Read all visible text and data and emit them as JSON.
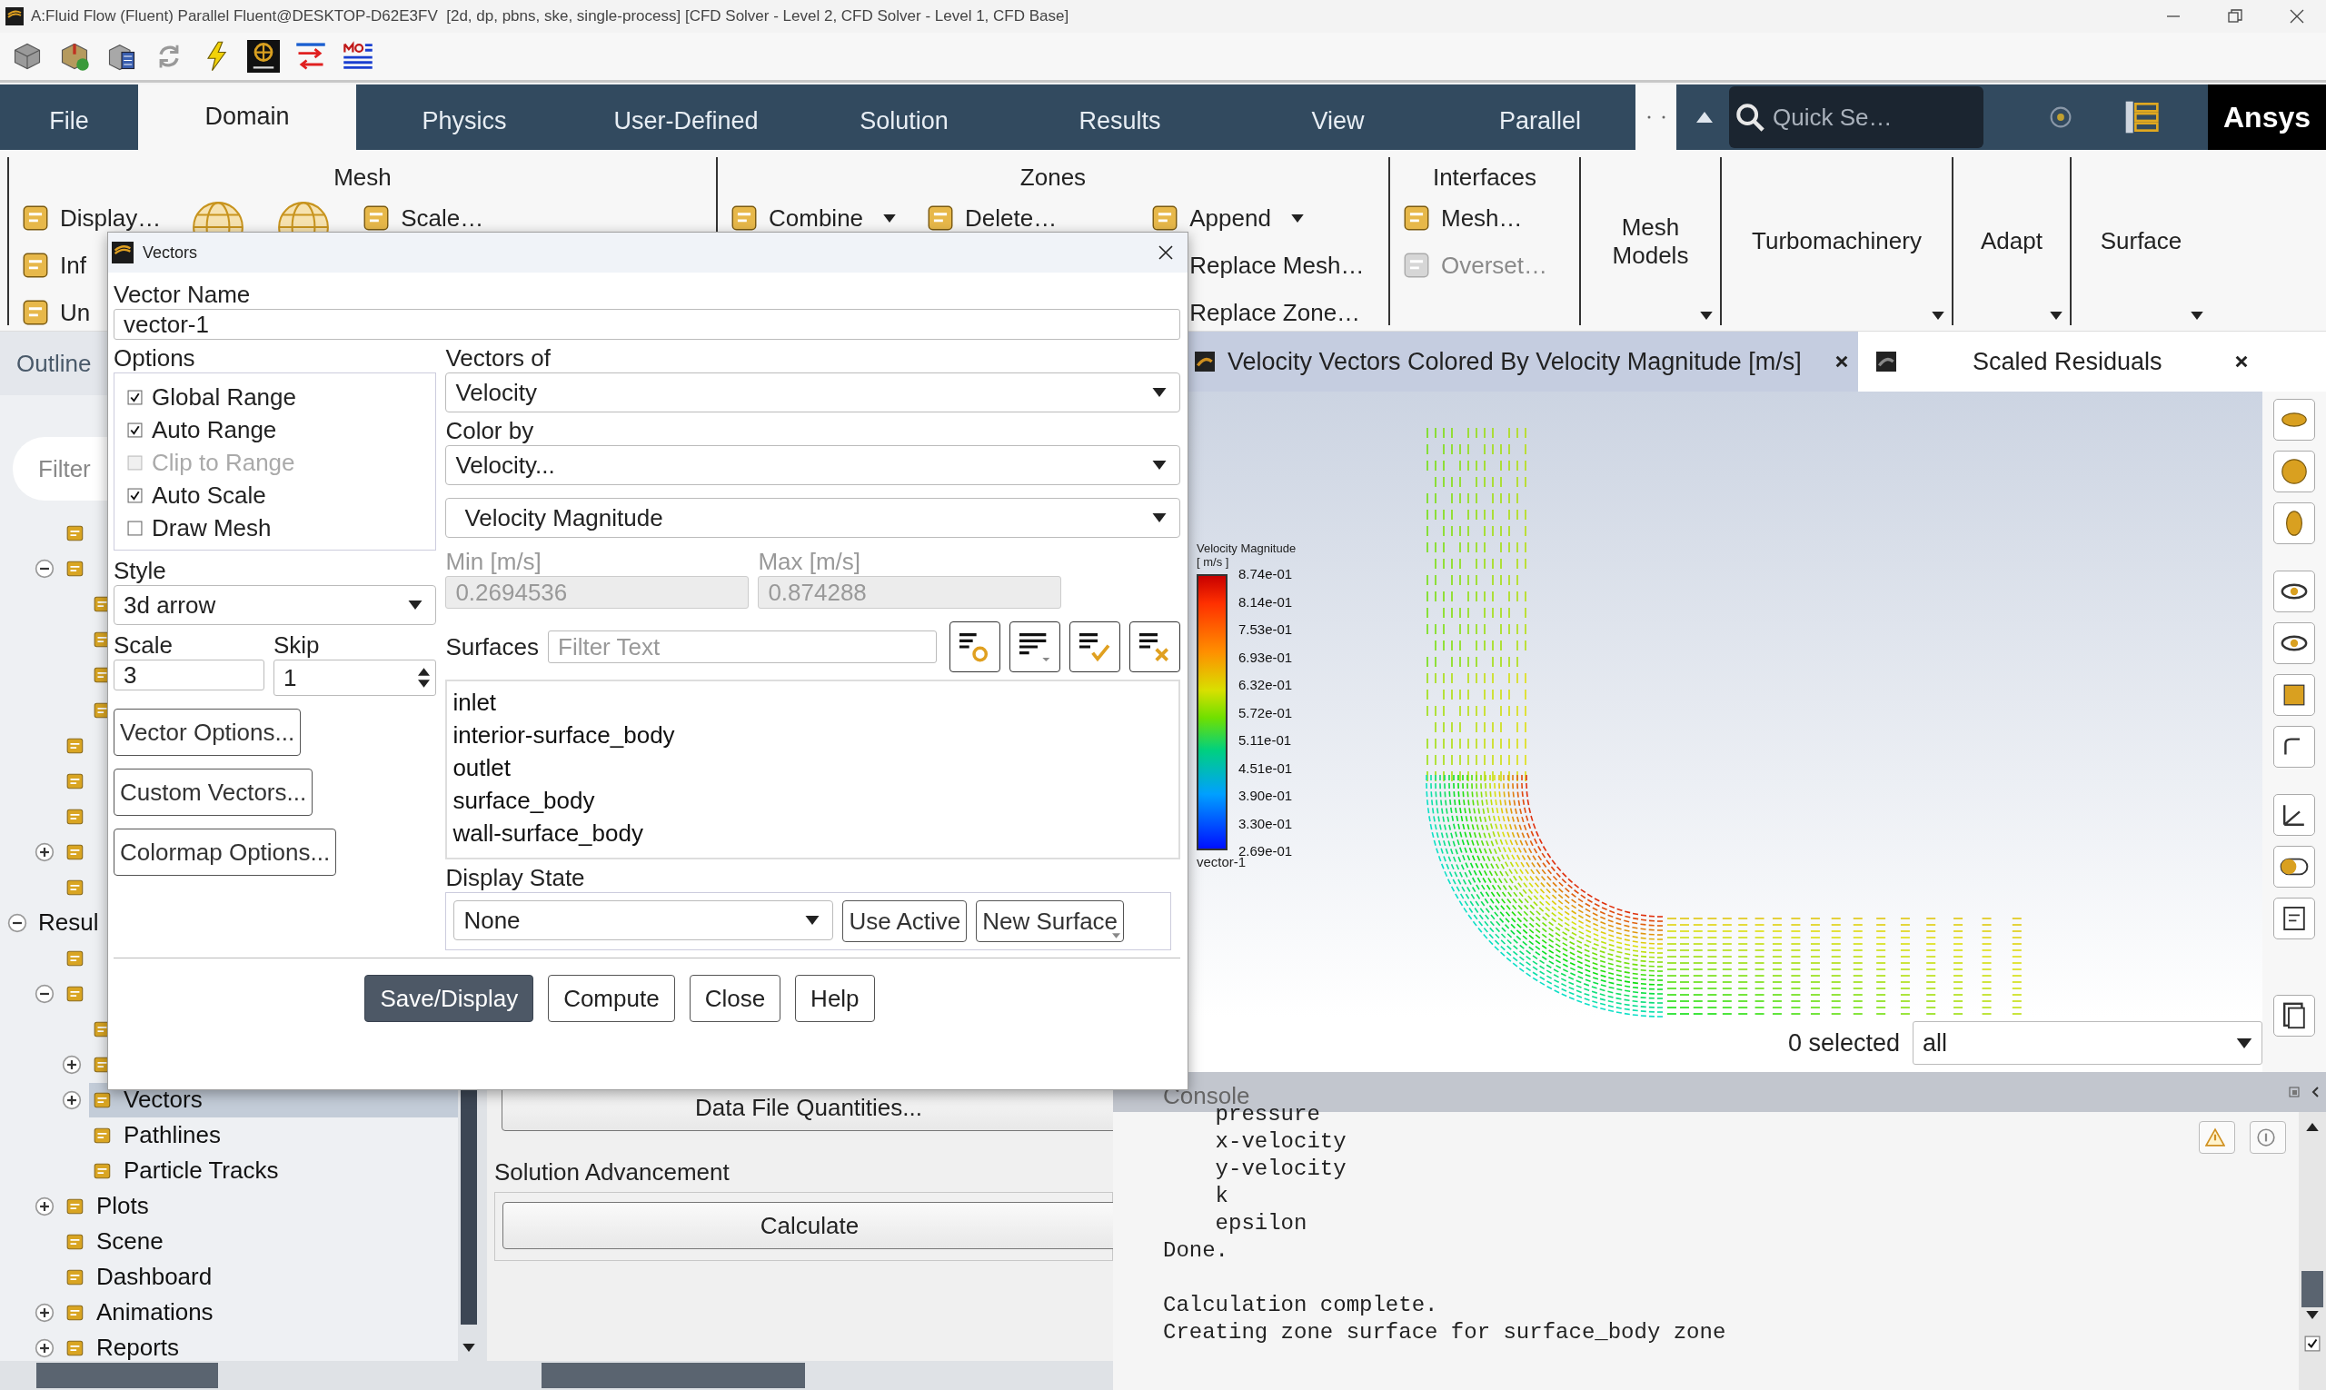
{
  "window": {
    "title": "A:Fluid Flow (Fluent) Parallel Fluent@DESKTOP-D62E3FV  [2d, dp, pbns, ske, single-process] [CFD Solver - Level 2, CFD Solver - Level 1, CFD Base]"
  },
  "ribbon_tabs": [
    {
      "label": "File",
      "selected": false
    },
    {
      "label": "Domain",
      "selected": true
    },
    {
      "label": "Physics",
      "selected": false
    },
    {
      "label": "User-Defined",
      "selected": false
    },
    {
      "label": "Solution",
      "selected": false
    },
    {
      "label": "Results",
      "selected": false
    },
    {
      "label": "View",
      "selected": false
    },
    {
      "label": "Parallel",
      "selected": false
    }
  ],
  "quick_search": {
    "placeholder": "Quick Se…"
  },
  "brand": "Ansys",
  "ribbon_groups": [
    {
      "title": "Mesh",
      "kind": "commands",
      "columns": [
        [
          {
            "kind": "command",
            "label": "Display…",
            "dropdown": false,
            "disabled": false
          },
          {
            "kind": "command",
            "label": "Inf",
            "dropdown": false,
            "disabled": false
          },
          {
            "kind": "command",
            "label": "Un",
            "dropdown": false,
            "disabled": false
          }
        ],
        [
          {
            "kind": "icon"
          }
        ],
        [
          {
            "kind": "icon"
          }
        ],
        [
          {
            "kind": "command",
            "label": "Scale…",
            "dropdown": false,
            "disabled": false
          }
        ]
      ]
    },
    {
      "title": "Zones",
      "kind": "commands",
      "columns": [
        [
          {
            "kind": "command",
            "label": "Combine",
            "dropdown": true,
            "disabled": false
          }
        ],
        [
          {
            "kind": "command",
            "label": "Delete…",
            "dropdown": false,
            "disabled": false
          }
        ],
        [
          {
            "kind": "command",
            "label": "Append",
            "dropdown": true,
            "disabled": false
          },
          {
            "kind": "command",
            "label": "Replace Mesh…",
            "dropdown": false,
            "disabled": false
          },
          {
            "kind": "command",
            "label": "Replace Zone…",
            "dropdown": false,
            "disabled": false
          }
        ]
      ]
    },
    {
      "title": "Interfaces",
      "kind": "commands",
      "columns": [
        [
          {
            "kind": "command",
            "label": "Mesh…",
            "dropdown": false,
            "disabled": false
          },
          {
            "kind": "command",
            "label": "Overset…",
            "dropdown": false,
            "disabled": true
          }
        ]
      ]
    },
    {
      "title": "Mesh Models",
      "kind": "menu"
    },
    {
      "title": "Turbomachinery",
      "kind": "menu"
    },
    {
      "title": "Adapt",
      "kind": "menu"
    },
    {
      "title": "Surface",
      "kind": "menu"
    }
  ],
  "outline": {
    "title": "Outline",
    "filter_placeholder": "Filter"
  },
  "tree": {
    "continued": [
      {
        "expandable": false,
        "selected": false
      },
      {
        "expandable": true,
        "expanded": true,
        "selected": false,
        "children": [
          {
            "expandable": false,
            "selected": false
          },
          {
            "expandable": false,
            "selected": false
          },
          {
            "expandable": false,
            "selected": false
          },
          {
            "expandable": false,
            "selected": false
          }
        ]
      },
      {
        "expandable": false,
        "selected": false
      },
      {
        "expandable": false,
        "selected": false
      },
      {
        "expandable": false,
        "selected": false
      },
      {
        "expandable": true,
        "expanded": false,
        "selected": false
      },
      {
        "expandable": false,
        "selected": false
      }
    ],
    "items": [
      {
        "label": "Resul",
        "expandable": true,
        "expanded": true,
        "selected": false,
        "children": [
          {
            "expandable": false,
            "selected": false
          },
          {
            "expandable": true,
            "expanded": true,
            "selected": false,
            "children": [
              {
                "expandable": false,
                "selected": false
              },
              {
                "expandable": true,
                "expanded": false,
                "selected": false
              },
              {
                "label": "Vectors",
                "expandable": true,
                "expanded": false,
                "selected": true
              },
              {
                "label": "Pathlines",
                "expandable": false,
                "selected": false
              },
              {
                "label": "Particle Tracks",
                "expandable": false,
                "selected": false
              }
            ]
          },
          {
            "label": "Plots",
            "expandable": true,
            "expanded": false,
            "selected": false
          },
          {
            "label": "Scene",
            "expandable": false,
            "selected": false
          },
          {
            "label": "Dashboard",
            "expandable": false,
            "selected": false
          },
          {
            "label": "Animations",
            "expandable": true,
            "expanded": false,
            "selected": false
          },
          {
            "label": "Reports",
            "expandable": true,
            "expanded": false,
            "selected": false
          }
        ]
      }
    ]
  },
  "task_page": {
    "data_button": "Data File Quantities...",
    "section": "Solution Advancement",
    "calculate_button": "Calculate"
  },
  "graphics_tabs": [
    {
      "label": "Velocity Vectors Colored By Velocity Magnitude [m/s]",
      "selected": true
    },
    {
      "label": "Scaled Residuals",
      "selected": false
    }
  ],
  "legend": {
    "title": "Velocity Magnitude",
    "units": "[ m/s ]",
    "ticks": [
      "8.74e-01",
      "8.14e-01",
      "7.53e-01",
      "6.93e-01",
      "6.32e-01",
      "5.72e-01",
      "5.11e-01",
      "4.51e-01",
      "3.90e-01",
      "3.30e-01",
      "2.69e-01"
    ],
    "name": "vector-1"
  },
  "selection": {
    "count": "0 selected",
    "filter": "all"
  },
  "console": {
    "title": "Console",
    "blocks": [
      [
        "    pressure",
        "    x-velocity",
        "    y-velocity",
        "    k",
        "    epsilon",
        "Done."
      ],
      [
        "Calculation complete.",
        "Creating zone surface for surface_body zone"
      ]
    ],
    "autoscroll": {
      "checked": true
    }
  },
  "vectors_dialog": {
    "title": "Vectors",
    "vector_name": {
      "label": "Vector Name",
      "value": "vector-1"
    },
    "options": {
      "label": "Options",
      "items": [
        {
          "label": "Global Range",
          "checked": true,
          "disabled": false
        },
        {
          "label": "Auto Range",
          "checked": true,
          "disabled": false
        },
        {
          "label": "Clip to Range",
          "checked": false,
          "disabled": true
        },
        {
          "label": "Auto Scale",
          "checked": true,
          "disabled": false
        },
        {
          "label": "Draw Mesh",
          "checked": false,
          "disabled": false
        }
      ]
    },
    "style": {
      "label": "Style",
      "value": "3d arrow"
    },
    "scale": {
      "label": "Scale",
      "value": "3"
    },
    "skip": {
      "label": "Skip",
      "value": "1"
    },
    "side_buttons": [
      "Vector Options...",
      "Custom Vectors...",
      "Colormap Options..."
    ],
    "vectors_of": {
      "label": "Vectors of",
      "value": "Velocity"
    },
    "color_by": {
      "label": "Color by",
      "value": "Velocity...",
      "component": "Velocity Magnitude"
    },
    "min": {
      "label": "Min [m/s]",
      "value": "0.2694536",
      "disabled": true
    },
    "max": {
      "label": "Max [m/s]",
      "value": "0.874288",
      "disabled": true
    },
    "surfaces": {
      "label": "Surfaces",
      "filter_placeholder": "Filter Text",
      "items": [
        {
          "label": "inlet",
          "selected": false
        },
        {
          "label": "interior-surface_body",
          "selected": false
        },
        {
          "label": "outlet",
          "selected": false
        },
        {
          "label": "surface_body",
          "selected": false
        },
        {
          "label": "wall-surface_body",
          "selected": false
        }
      ]
    },
    "display_state": {
      "label": "Display State",
      "value": "None",
      "buttons": [
        "Use Active",
        "New Surface"
      ]
    },
    "buttons": [
      {
        "label": "Save/Display",
        "default": true
      },
      {
        "label": "Compute",
        "default": false
      },
      {
        "label": "Close",
        "default": false
      },
      {
        "label": "Help",
        "default": false
      }
    ]
  }
}
